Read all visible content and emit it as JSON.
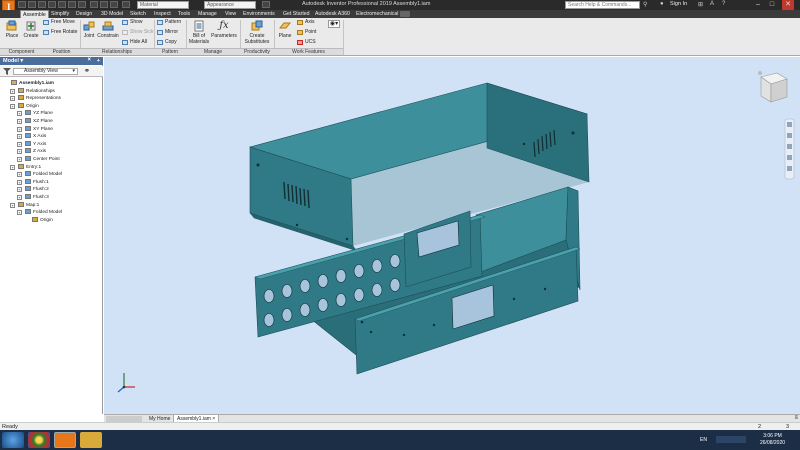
{
  "titlebar": {
    "title": "Autodesk Inventor Professional 2019    Assembly1.iam",
    "combo_material": "Material",
    "combo_appearance": "Appearance",
    "search_placeholder": "Search Help & Commands...",
    "signin": "Sign In",
    "win_min": "–",
    "win_max": "□",
    "win_close": "✕"
  },
  "tabs": [
    "Assemble",
    "Simplify",
    "Design",
    "3D Model",
    "Sketch",
    "Inspect",
    "Tools",
    "Manage",
    "View",
    "Environments",
    "Get Started",
    "Autodesk A360",
    "Electromechanical"
  ],
  "active_tab": "Assemble",
  "ribbon": {
    "place": "Place",
    "create": "Create",
    "free_move": "Free Move",
    "free_rotate": "Free Rotate",
    "joint": "Joint",
    "constrain": "Constrain",
    "show": "Show",
    "show_sick": "Show Sick",
    "hide_all": "Hide All",
    "pattern": "Pattern",
    "mirror": "Mirror",
    "copy": "Copy",
    "bom_line1": "Bill of",
    "bom_line2": "Materials",
    "parameters": "Parameters",
    "create_sub_line1": "Create",
    "create_sub_line2": "Substitutes",
    "plane": "Plane",
    "axis": "Axis",
    "point": "Point",
    "ucs": "UCS",
    "panels": {
      "component": "Component",
      "position": "Position",
      "relationships": "Relationships",
      "pattern": "Pattern",
      "manage": "Manage",
      "productivity": "Productivity",
      "work_features": "Work Features"
    }
  },
  "browser": {
    "header": "Model",
    "view_combo": "Assembly View",
    "tree": [
      {
        "label": "Assembly1.iam",
        "level": 0,
        "bold": true
      },
      {
        "label": "Relationships",
        "level": 1
      },
      {
        "label": "Representations",
        "level": 1
      },
      {
        "label": "Origin",
        "level": 1
      },
      {
        "label": "YZ Plane",
        "level": 2
      },
      {
        "label": "XZ Plane",
        "level": 2
      },
      {
        "label": "XY Plane",
        "level": 2
      },
      {
        "label": "X Axis",
        "level": 2
      },
      {
        "label": "Y Axis",
        "level": 2
      },
      {
        "label": "Z Axis",
        "level": 2
      },
      {
        "label": "Center Point",
        "level": 2
      },
      {
        "label": "Entry:1",
        "level": 1
      },
      {
        "label": "Folded Model",
        "level": 2
      },
      {
        "label": "Flush:1",
        "level": 2
      },
      {
        "label": "Flush:2",
        "level": 2
      },
      {
        "label": "Flush:3",
        "level": 2
      },
      {
        "label": "Map:1",
        "level": 1
      },
      {
        "label": "Folded Model",
        "level": 2
      },
      {
        "label": "Origin",
        "level": 3
      }
    ]
  },
  "viewtabs": [
    "My Home",
    "Assembly1.iam"
  ],
  "status": {
    "left": "Ready",
    "count1": "2",
    "count2": "3"
  },
  "taskbar": {
    "lang": "EN",
    "time": "3:06 PM",
    "date": "26/08/2020"
  },
  "colors": {
    "part": "#2f7a86",
    "part_dark": "#1f5c66",
    "part_light": "#3c8f9b",
    "viewport_bg": "#d2e2f6"
  }
}
